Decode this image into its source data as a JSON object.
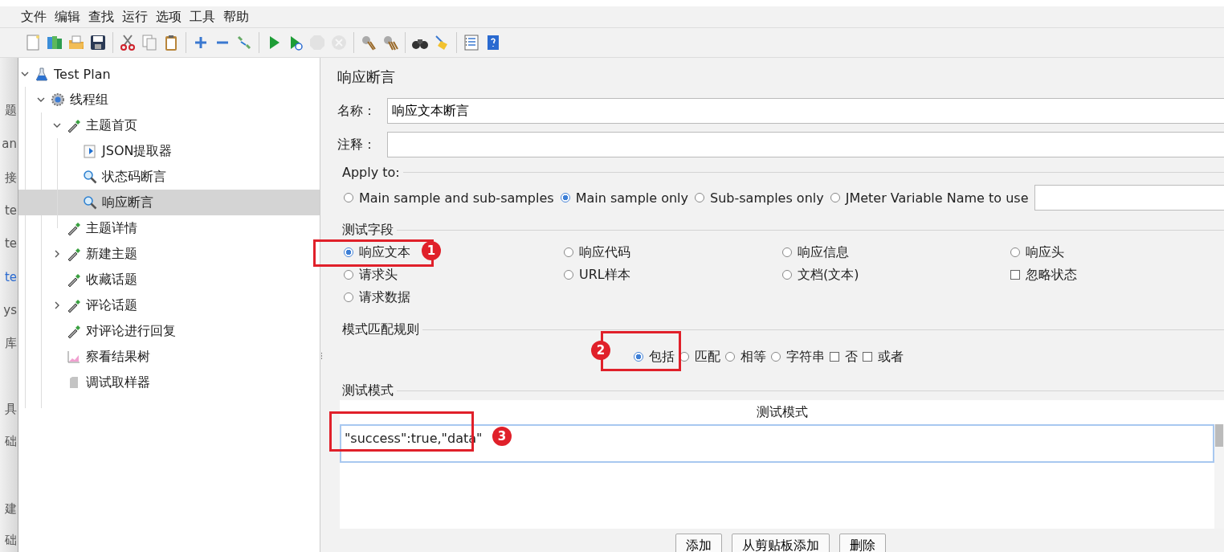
{
  "background_window": [
    {
      "text": "题",
      "color": "#555555"
    },
    {
      "text": "an",
      "color": "#555555"
    },
    {
      "text": "接",
      "color": "#555555"
    },
    {
      "text": "te",
      "color": "#555555"
    },
    {
      "text": "te",
      "color": "#555555"
    },
    {
      "text": "te",
      "color": "#2a6ad0"
    },
    {
      "text": "ys",
      "color": "#555555"
    },
    {
      "text": "库",
      "color": "#555555"
    },
    {
      "text": "具",
      "color": "#555555"
    },
    {
      "text": "础",
      "color": "#555555"
    },
    {
      "text": "建",
      "color": "#555555"
    },
    {
      "text": "础",
      "color": "#555555"
    }
  ],
  "menu": [
    "文件",
    "编辑",
    "查找",
    "运行",
    "选项",
    "工具",
    "帮助"
  ],
  "toolbar": [
    {
      "kind": "new",
      "disabled": false
    },
    {
      "kind": "templates",
      "disabled": false
    },
    {
      "kind": "open",
      "disabled": false
    },
    {
      "kind": "save",
      "disabled": false
    },
    {
      "kind": "separator",
      "disabled": false
    },
    {
      "kind": "cut",
      "disabled": false
    },
    {
      "kind": "copy",
      "disabled": false
    },
    {
      "kind": "paste",
      "disabled": false
    },
    {
      "kind": "separator",
      "disabled": false
    },
    {
      "kind": "expand",
      "disabled": false
    },
    {
      "kind": "collapse",
      "disabled": false
    },
    {
      "kind": "toggle",
      "disabled": false
    },
    {
      "kind": "separator",
      "disabled": false
    },
    {
      "kind": "start",
      "disabled": false
    },
    {
      "kind": "start_no_pause",
      "disabled": false
    },
    {
      "kind": "stop",
      "disabled": true
    },
    {
      "kind": "shutdown",
      "disabled": true
    },
    {
      "kind": "separator",
      "disabled": false
    },
    {
      "kind": "clear",
      "disabled": false
    },
    {
      "kind": "clear_all",
      "disabled": false
    },
    {
      "kind": "separator",
      "disabled": false
    },
    {
      "kind": "search",
      "disabled": false
    },
    {
      "kind": "reset",
      "disabled": false
    },
    {
      "kind": "separator",
      "disabled": false
    },
    {
      "kind": "function_helper",
      "disabled": false
    },
    {
      "kind": "help",
      "disabled": false
    }
  ],
  "tree": [
    {
      "label": "Test Plan",
      "kind": "plan",
      "expanded": true,
      "has_children": true,
      "selected": false,
      "children": [
        {
          "label": "线程组",
          "kind": "thread_group",
          "expanded": true,
          "has_children": true,
          "selected": false,
          "children": [
            {
              "label": "主题首页",
              "kind": "controller",
              "expanded": true,
              "has_children": true,
              "selected": false,
              "children": [
                {
                  "label": "JSON提取器",
                  "kind": "extractor",
                  "expanded": false,
                  "has_children": false,
                  "selected": false
                },
                {
                  "label": "状态码断言",
                  "kind": "assertion",
                  "expanded": false,
                  "has_children": false,
                  "selected": false
                },
                {
                  "label": "响应断言",
                  "kind": "assertion",
                  "expanded": false,
                  "has_children": false,
                  "selected": true
                }
              ]
            },
            {
              "label": "主题详情",
              "kind": "controller",
              "expanded": false,
              "has_children": false,
              "selected": false
            },
            {
              "label": "新建主题",
              "kind": "controller",
              "expanded": false,
              "has_children": true,
              "selected": false
            },
            {
              "label": "收藏话题",
              "kind": "controller",
              "expanded": false,
              "has_children": false,
              "selected": false
            },
            {
              "label": "评论话题",
              "kind": "controller",
              "expanded": false,
              "has_children": true,
              "selected": false
            },
            {
              "label": "对评论进行回复",
              "kind": "controller",
              "expanded": false,
              "has_children": false,
              "selected": false
            },
            {
              "label": "察看结果树",
              "kind": "listener",
              "expanded": false,
              "has_children": false,
              "selected": false
            },
            {
              "label": "调试取样器",
              "kind": "sampler",
              "expanded": false,
              "has_children": false,
              "selected": false
            }
          ]
        }
      ]
    }
  ],
  "form": {
    "title": "响应断言",
    "name": {
      "label": "名称：",
      "value": "响应文本断言"
    },
    "comment": {
      "label": "注释："
    },
    "apply_to": {
      "title": "Apply to:",
      "options": [
        {
          "label": "Main sample and sub-samples",
          "selected": false
        },
        {
          "label": "Main sample only",
          "selected": true
        },
        {
          "label": "Sub-samples only",
          "selected": false
        },
        {
          "label": "JMeter Variable Name to use",
          "selected": false
        }
      ]
    },
    "test_field": {
      "title": "测试字段",
      "options": [
        {
          "label": "响应文本",
          "kind": "radio",
          "selected": true
        },
        {
          "label": "响应代码",
          "kind": "radio",
          "selected": false
        },
        {
          "label": "响应信息",
          "kind": "radio",
          "selected": false
        },
        {
          "label": "响应头",
          "kind": "radio",
          "selected": false
        },
        {
          "label": "请求头",
          "kind": "radio",
          "selected": false
        },
        {
          "label": "URL样本",
          "kind": "radio",
          "selected": false
        },
        {
          "label": "文档(文本)",
          "kind": "radio",
          "selected": false
        },
        {
          "label": "忽略状态",
          "kind": "checkbox",
          "selected": false
        },
        {
          "label": "请求数据",
          "kind": "radio",
          "selected": false
        }
      ]
    },
    "pattern_rules": {
      "title": "模式匹配规则",
      "options": [
        {
          "label": "包括",
          "kind": "radio",
          "selected": true
        },
        {
          "label": "匹配",
          "kind": "radio",
          "selected": false
        },
        {
          "label": "相等",
          "kind": "radio",
          "selected": false
        },
        {
          "label": "字符串",
          "kind": "radio",
          "selected": false
        },
        {
          "label": "否",
          "kind": "checkbox",
          "selected": false
        },
        {
          "label": "或者",
          "kind": "checkbox",
          "selected": false
        }
      ]
    },
    "patterns": {
      "title": "测试模式",
      "column": "测试模式",
      "rows": [
        {
          "value": "\"success\":true,\"data\"",
          "selected": true
        }
      ]
    },
    "buttons": [
      "添加",
      "从剪贴板添加",
      "删除"
    ]
  },
  "annotations": [
    {
      "label": "1"
    },
    {
      "label": "2"
    },
    {
      "label": "3"
    }
  ]
}
